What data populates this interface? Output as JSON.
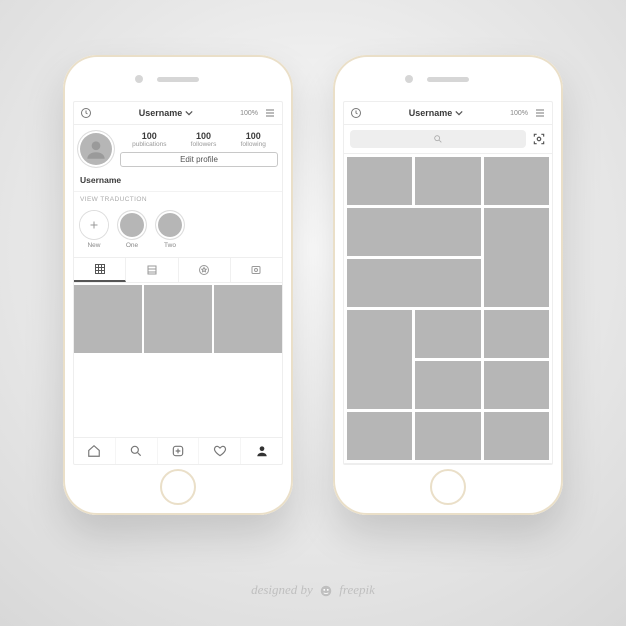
{
  "battery_pct": "100%",
  "header_title": "Username",
  "profile": {
    "stats": [
      {
        "value": "100",
        "label": "publications"
      },
      {
        "value": "100",
        "label": "followers"
      },
      {
        "value": "100",
        "label": "following"
      }
    ],
    "edit_btn": "Edit profile",
    "display_name": "Username",
    "view_translation": "VIEW TRADUCTION",
    "highlights": [
      {
        "label": "New"
      },
      {
        "label": "One"
      },
      {
        "label": "Two"
      }
    ]
  },
  "credit_prefix": "designed by",
  "credit_brand": "freepik"
}
